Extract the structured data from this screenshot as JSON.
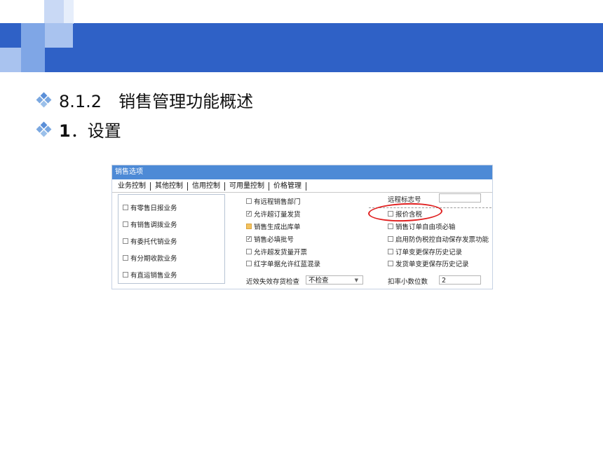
{
  "slide": {
    "heading1": "8.1.2　销售管理功能概述",
    "heading2_num": "1",
    "heading2_text": "．设置",
    "colors": {
      "band": "#2f61c6",
      "accent_light": "#a9c3ef",
      "ring": "#e02020"
    }
  },
  "dialog": {
    "title": "销售选项",
    "tabs": [
      "业务控制",
      "其他控制",
      "信用控制",
      "可用量控制",
      "价格管理"
    ],
    "left_options": [
      {
        "label": "有零售日报业务",
        "checked": false
      },
      {
        "label": "有销售调拨业务",
        "checked": false
      },
      {
        "label": "有委托代销业务",
        "checked": false
      },
      {
        "label": "有分期收款业务",
        "checked": false
      },
      {
        "label": "有直运销售业务",
        "checked": false
      }
    ],
    "middle_options": [
      {
        "label": "有远程销售部门",
        "checked": false
      },
      {
        "label": "允许超订量发货",
        "checked": true
      },
      {
        "label": "销售生成出库单",
        "checked": false,
        "locked": true
      },
      {
        "label": "销售必填批号",
        "checked": true
      },
      {
        "label": "允许超发货量开票",
        "checked": false
      },
      {
        "label": "红字单据允许红蓝混录",
        "checked": false
      }
    ],
    "remote_label": "远程标志号",
    "remote_value": "",
    "right_options": [
      {
        "label": "报价含税",
        "checked": false
      },
      {
        "label": "销售订单自由项必输",
        "checked": false
      },
      {
        "label": "启用防伪税控自动保存发票功能",
        "checked": false
      },
      {
        "label": "订单变更保存历史记录",
        "checked": false
      },
      {
        "label": "发货单变更保存历史记录",
        "checked": false
      }
    ],
    "expiry_label": "近效失效存货检查",
    "expiry_value": "不检查",
    "discount_label": "扣率小数位数",
    "discount_value": "2"
  }
}
